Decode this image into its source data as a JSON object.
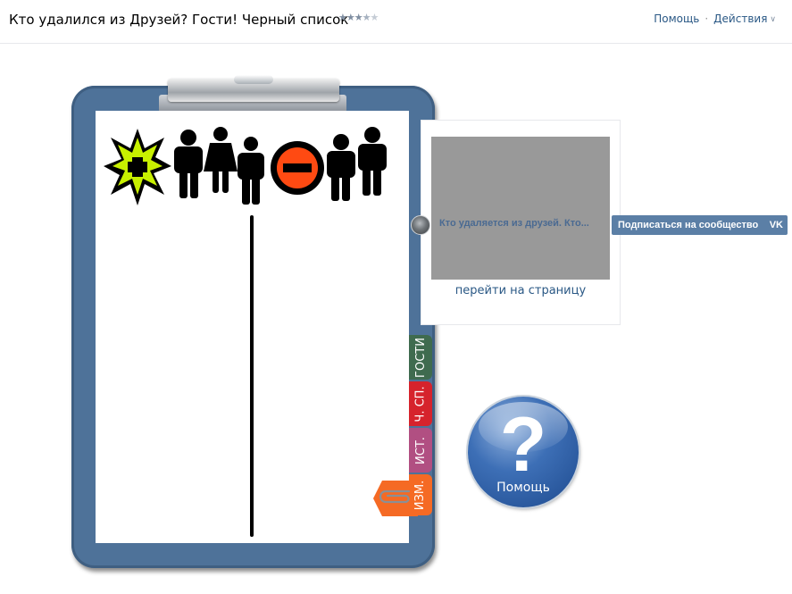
{
  "header": {
    "title": "Кто удалился из Друзей? Гости! Черный список",
    "rating": {
      "value": 3.5,
      "max": 5,
      "stars_on": "★★★",
      "star_half": "★",
      "stars_off": "★"
    },
    "help_link": "Помощь",
    "separator": "·",
    "actions_link": "Действия",
    "actions_icon": "chevron-down-icon"
  },
  "clipboard": {
    "tabs": {
      "guests": "ГОСТИ",
      "blacklist": "Ч. СП.",
      "history": "ИСТ.",
      "edit": "ИЗМ."
    },
    "icons": [
      "add-burst-icon",
      "people-added-icon",
      "remove-circle-icon",
      "people-removed-icon",
      "paperclip-icon"
    ]
  },
  "widget": {
    "caption": "Кто удаляется из друзей. Кто...",
    "link": "перейти на страницу",
    "subscribe": "Подписаться на сообщество",
    "vk_label": "VK"
  },
  "help_button": {
    "label": "Помощь",
    "symbol": "?"
  },
  "colors": {
    "link": "#2a5885",
    "clipboard": "#4e7299",
    "tab_guests": "#3f6b4f",
    "tab_blacklist": "#d6232c",
    "tab_history": "#b14f82",
    "tab_edit": "#f56a24",
    "subscribe_button": "#5b7fa6"
  }
}
